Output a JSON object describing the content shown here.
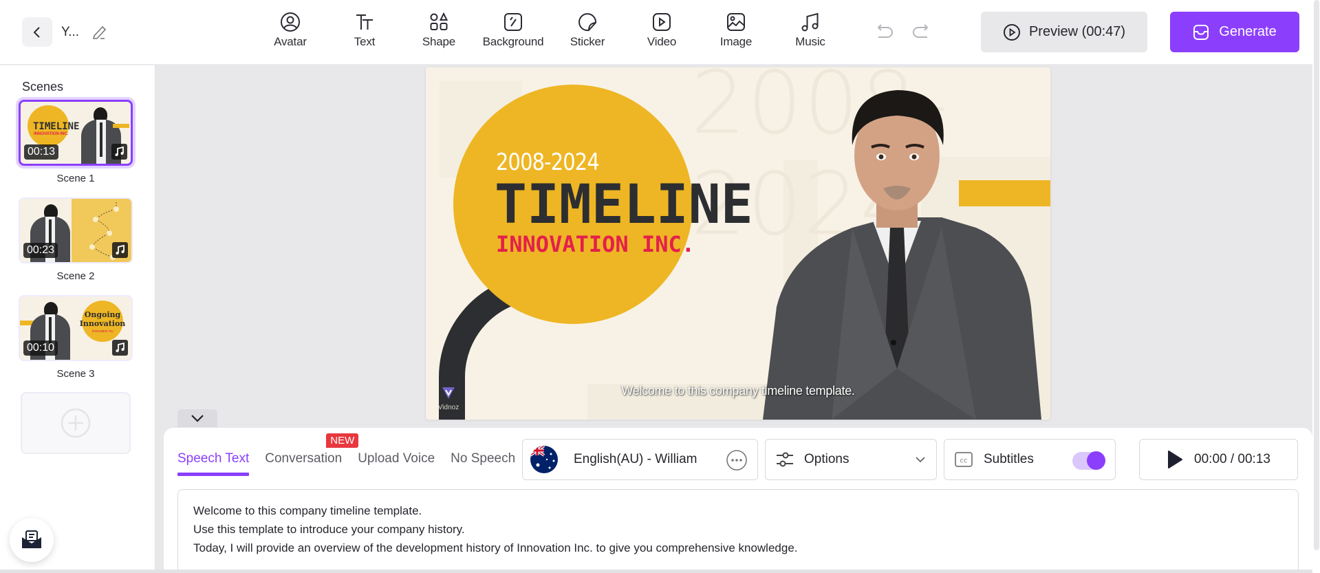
{
  "header": {
    "back_label": "Back",
    "project_title": "Y...",
    "tools": [
      {
        "icon": "avatar-icon",
        "label": "Avatar"
      },
      {
        "icon": "text-icon",
        "label": "Text"
      },
      {
        "icon": "shape-icon",
        "label": "Shape"
      },
      {
        "icon": "background-icon",
        "label": "Background"
      },
      {
        "icon": "sticker-icon",
        "label": "Sticker"
      },
      {
        "icon": "video-icon",
        "label": "Video"
      },
      {
        "icon": "image-icon",
        "label": "Image"
      },
      {
        "icon": "music-icon",
        "label": "Music"
      }
    ],
    "preview_label": "Preview (00:47)",
    "generate_label": "Generate"
  },
  "sidebar": {
    "title": "Scenes",
    "scenes": [
      {
        "label": "Scene 1",
        "duration": "00:13",
        "active": true,
        "thumb_title": "TIMELINE",
        "thumb_sub": "INNOVATION INC."
      },
      {
        "label": "Scene 2",
        "duration": "00:23",
        "active": false
      },
      {
        "label": "Scene 3",
        "duration": "00:10",
        "active": false,
        "thumb_title": "Ongoing Innovation",
        "thumb_sub": "Innovation Inc."
      }
    ]
  },
  "canvas": {
    "background_years": "2008-2024",
    "years": "2008-2024",
    "title": "TIMELINE",
    "company": "INNOVATION INC.",
    "subtitle": "Welcome to this company timeline template.",
    "watermark": "Vidnoz",
    "colors": {
      "yellow": "#eeb624",
      "red": "#e3204b",
      "dark": "#2d2e31",
      "cream": "#f8f2e6"
    }
  },
  "panel": {
    "tabs": [
      {
        "label": "Speech Text",
        "active": true
      },
      {
        "label": "Conversation",
        "badge": "NEW"
      },
      {
        "label": "Upload Voice"
      },
      {
        "label": "No Speech"
      }
    ],
    "voice": "English(AU) - William",
    "options_label": "Options",
    "subtitles_label": "Subtitles",
    "subtitles_enabled": true,
    "playback_time": "00:00 / 00:13",
    "speech_lines": [
      "Welcome to this company timeline template.",
      "Use this template to introduce your company history.",
      "Today, I will provide an overview of the development history of Innovation Inc. to give you comprehensive knowledge."
    ]
  },
  "theme": {
    "accent": "#8b3ffc",
    "badge": "#e8373e"
  }
}
